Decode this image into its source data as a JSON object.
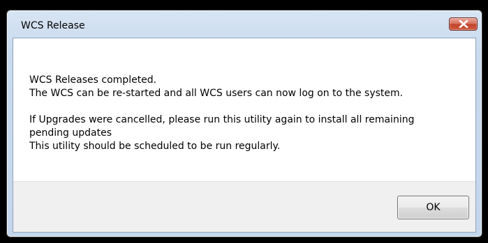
{
  "window": {
    "title": "WCS Release",
    "close_icon": "close-x-icon",
    "close_color": "#c9452d"
  },
  "message": {
    "line1": "WCS Releases completed.",
    "line2": "The WCS can be re-started and all WCS users can now log on to the system.",
    "line3": "If Upgrades were cancelled, please run this utility again to install all remaining",
    "line4": "pending updates",
    "line5": "This utility should be scheduled to be run regularly."
  },
  "buttons": {
    "ok_label": "OK"
  }
}
